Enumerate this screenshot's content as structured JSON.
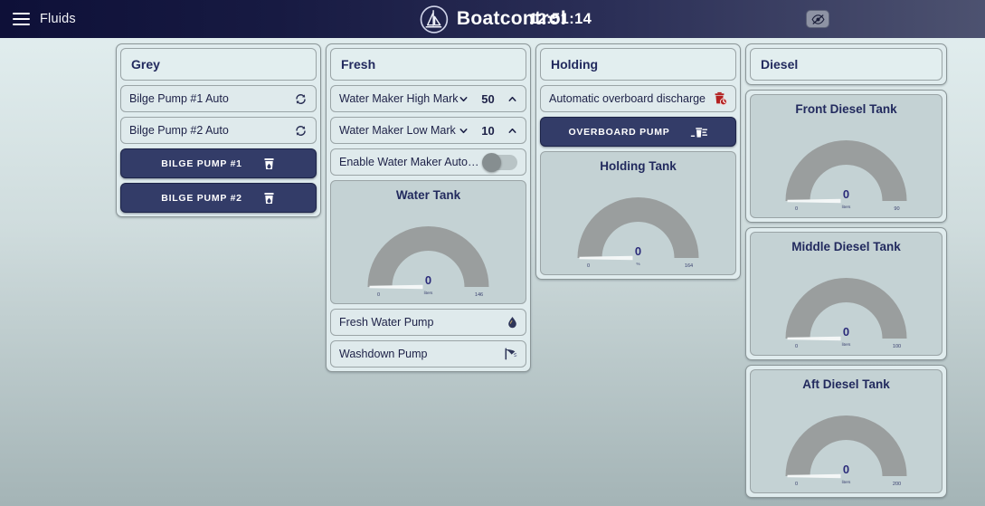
{
  "header": {
    "menu_label": "Fluids",
    "menu_icon": "hamburger-icon",
    "brand": "Boatcontrol",
    "brand_icon": "sailboat-logo",
    "clock": "12:51:14",
    "visibility_icon": "eye-slash-icon"
  },
  "columns": [
    {
      "title": "Grey",
      "rows": [
        {
          "type": "plain",
          "label": "Bilge Pump #1 Auto",
          "icon": "auto-cycle-icon"
        },
        {
          "type": "plain",
          "label": "Bilge Pump #2 Auto",
          "icon": "auto-cycle-icon"
        },
        {
          "type": "dark",
          "label": "BILGE PUMP #1",
          "icon": "bilge-pump-icon"
        },
        {
          "type": "dark",
          "label": "BILGE PUMP #2",
          "icon": "bilge-pump-icon"
        }
      ]
    },
    {
      "title": "Fresh",
      "rows": [
        {
          "type": "stepper",
          "label": "Water Maker High Mark",
          "value": "50",
          "down_icon": "chevron-down-icon",
          "up_icon": "chevron-up-icon"
        },
        {
          "type": "stepper",
          "label": "Water Maker Low Mark",
          "value": "10",
          "down_icon": "chevron-down-icon",
          "up_icon": "chevron-up-icon"
        },
        {
          "type": "toggle",
          "label": "Enable Water Maker Autostart",
          "state": "off"
        },
        {
          "type": "gauge",
          "gauge": {
            "title": "Water Tank",
            "value": "0",
            "unit": "liters",
            "min": "0",
            "max": "146",
            "percent": 0
          }
        },
        {
          "type": "plain",
          "label": "Fresh Water Pump",
          "icon": "water-drop-icon"
        },
        {
          "type": "plain",
          "label": "Washdown Pump",
          "icon": "shower-head-icon"
        }
      ]
    },
    {
      "title": "Holding",
      "rows": [
        {
          "type": "plain",
          "label": "Automatic overboard discharge",
          "icon": "discharge-timer-icon"
        },
        {
          "type": "dark",
          "label": "OVERBOARD PUMP",
          "icon": "overboard-pump-icon"
        },
        {
          "type": "gauge",
          "gauge": {
            "title": "Holding Tank",
            "value": "0",
            "unit": "%",
            "min": "0",
            "max": "164",
            "percent": 0
          }
        }
      ]
    },
    {
      "title": "Diesel",
      "rows": [
        {
          "type": "gauge",
          "gauge": {
            "title": "Front Diesel Tank",
            "value": "0",
            "unit": "liters",
            "min": "0",
            "max": "90",
            "percent": 0
          }
        },
        {
          "type": "gauge",
          "gauge": {
            "title": "Middle Diesel Tank",
            "value": "0",
            "unit": "liters",
            "min": "0",
            "max": "100",
            "percent": 0
          }
        },
        {
          "type": "gauge",
          "gauge": {
            "title": "Aft Diesel Tank",
            "value": "0",
            "unit": "liters",
            "min": "0",
            "max": "200",
            "percent": 0
          }
        }
      ]
    }
  ],
  "theme": {
    "appbar_start": "#0e1038",
    "appbar_end": "#4d5270",
    "dark_button": "#333c68",
    "panel_bg": "#e0ecee",
    "gauge_card_bg": "#c4d2d4",
    "gauge_track": "#9a9e9e",
    "accent_text": "#222a5e",
    "danger": "#b32020"
  }
}
